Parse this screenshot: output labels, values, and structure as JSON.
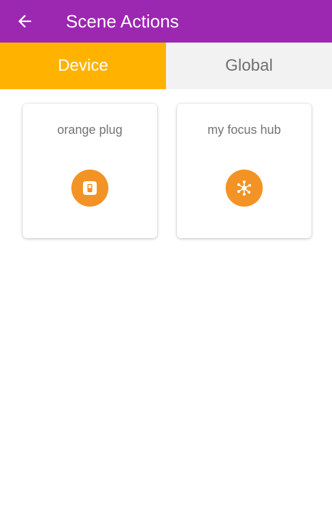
{
  "appbar": {
    "title": "Scene Actions",
    "back_icon": "arrow-left-icon",
    "color": "#9C27B0"
  },
  "tabs": [
    {
      "label": "Device",
      "selected": true,
      "color": "#FFB300"
    },
    {
      "label": "Global",
      "selected": false,
      "color": "#F2F2F2"
    }
  ],
  "devices": [
    {
      "name": "orange plug",
      "icon": "plug-icon",
      "icon_color": "#F39325"
    },
    {
      "name": "my focus hub",
      "icon": "hub-icon",
      "icon_color": "#F39325"
    }
  ]
}
